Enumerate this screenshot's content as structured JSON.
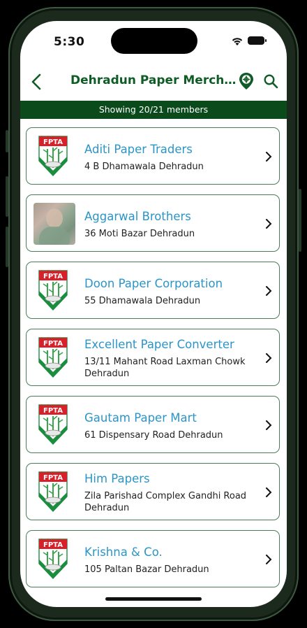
{
  "status_bar": {
    "time": "5:30"
  },
  "navbar": {
    "title": "Dehradun Paper Merchant..."
  },
  "banner": {
    "text": "Showing 20/21 members"
  },
  "colors": {
    "brand_green": "#0b4a1b",
    "title_green": "#0f5c26",
    "link_blue": "#2a95c8",
    "logo_red": "#d8202a"
  },
  "logo": {
    "text": "FPTA"
  },
  "members": [
    {
      "name": "Aditi Paper Traders",
      "address": "4 B Dhamawala Dehradun",
      "icon": "fpta-logo"
    },
    {
      "name": "Aggarwal Brothers",
      "address": "36 Moti Bazar Dehradun",
      "icon": "member-photo"
    },
    {
      "name": "Doon Paper Corporation",
      "address": "55 Dhamawala Dehradun",
      "icon": "fpta-logo"
    },
    {
      "name": "Excellent Paper Converter",
      "address": "13/11 Mahant Road Laxman Chowk Dehradun",
      "icon": "fpta-logo"
    },
    {
      "name": "Gautam Paper Mart",
      "address": "61 Dispensary Road Dehradun",
      "icon": "fpta-logo"
    },
    {
      "name": "Him Papers",
      "address": "Zila Parishad Complex Gandhi Road Dehradun",
      "icon": "fpta-logo"
    },
    {
      "name": "Krishna & Co.",
      "address": "105 Paltan Bazar Dehradun",
      "icon": "fpta-logo"
    }
  ]
}
